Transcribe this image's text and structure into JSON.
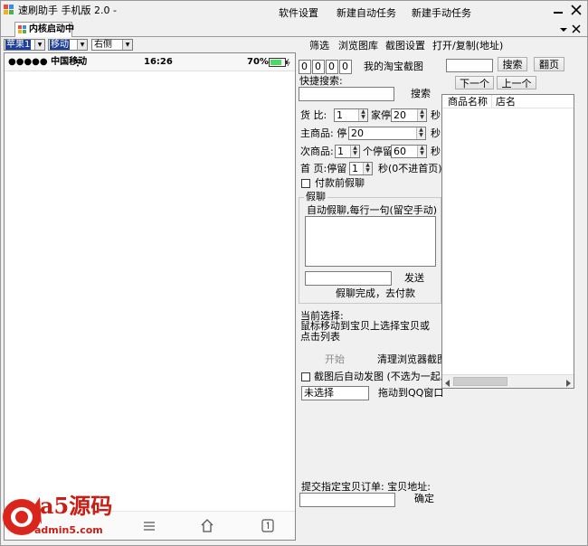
{
  "window": {
    "title": "速刷助手 手机版 2.0 -",
    "menu": [
      "软件设置",
      "新建自动任务",
      "新建手动任务"
    ],
    "tab": "内核启动中"
  },
  "toolbar": {
    "combo1": "苹果1",
    "combo2": "移动",
    "combo3": "右侧"
  },
  "phone": {
    "carrier": "●●●●● 中国移动",
    "time": "16:26",
    "battery": "70%"
  },
  "top_menu": [
    "筛选",
    "浏览图库",
    "截图设置",
    "打开/复制(地址)"
  ],
  "counters": [
    "0",
    "0",
    "0",
    "0"
  ],
  "my_screenshot": "我的淘宝截图",
  "quick_search_label": "快捷搜索:",
  "search_label": "搜索",
  "flip_label": "翻页",
  "next_label": "下一个",
  "prev_label": "上一个",
  "goods_ratio": {
    "label": "货  比:",
    "value": "1",
    "mid": "家停",
    "sec": "20",
    "unit": "秒"
  },
  "main_item": {
    "label": "主商品:  停",
    "value": "20",
    "unit": "秒"
  },
  "sub_item": {
    "label": "次商品:",
    "value": "1",
    "mid": "个停留",
    "sec": "60",
    "unit": "秒"
  },
  "home_page": {
    "label": "首   页:停留",
    "value": "1",
    "note": "秒(0不进首页)"
  },
  "pay_chat": "付款前假聊",
  "fake_chat": {
    "group": "假聊",
    "hint": "自动假聊,每行一句(留空手动)",
    "send": "发送",
    "done": "假聊完成，去付款"
  },
  "current": {
    "label": "当前选择:",
    "hint": "鼠标移动到宝贝上选择宝贝或点击列表"
  },
  "start_label": "开始",
  "clear_label": "清理浏览器截图",
  "auto_send": "截图后自动发图 (不选为一起发送)",
  "unselected": "未选择",
  "drag_qq": "拖动到QQ窗口",
  "submit_label": "提交指定宝贝订单: 宝贝地址:",
  "confirm_label": "确定",
  "table": {
    "columns": [
      "商品名称",
      "店名"
    ]
  },
  "watermark": {
    "brand": "a5源码",
    "site": "admin5.com"
  }
}
